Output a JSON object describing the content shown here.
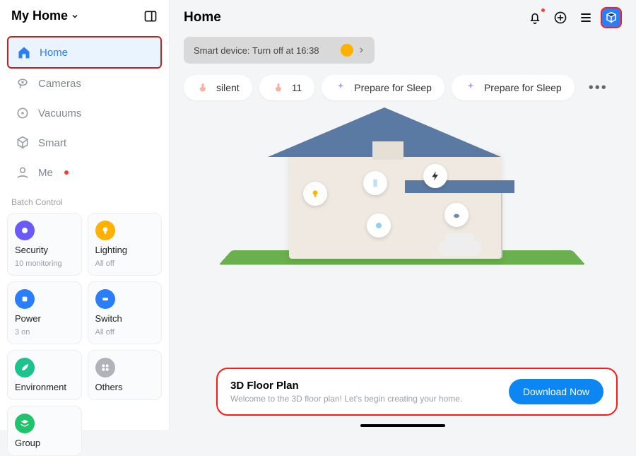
{
  "sidebar": {
    "title": "My Home",
    "nav": [
      {
        "label": "Home",
        "icon": "home"
      },
      {
        "label": "Cameras",
        "icon": "camera"
      },
      {
        "label": "Vacuums",
        "icon": "vacuum"
      },
      {
        "label": "Smart",
        "icon": "cube"
      },
      {
        "label": "Me",
        "icon": "person",
        "dot": true
      }
    ],
    "batch_label": "Batch Control",
    "batch": [
      {
        "t1": "Security",
        "t2": "10 monitoring",
        "color": "#6a5af9",
        "icon": "camera"
      },
      {
        "t1": "Lighting",
        "t2": "All off",
        "color": "#ffb100",
        "icon": "bulb"
      },
      {
        "t1": "Power",
        "t2": "3 on",
        "color": "#2a7efc",
        "icon": "plug"
      },
      {
        "t1": "Switch",
        "t2": "All off",
        "color": "#2a7efc",
        "icon": "switch"
      },
      {
        "t1": "Environment",
        "t2": "",
        "color": "#1dc28f",
        "icon": "leaf"
      },
      {
        "t1": "Others",
        "t2": "",
        "color": "#b0b4ba",
        "icon": "grid"
      },
      {
        "t1": "Group",
        "t2": "",
        "color": "#1fc36b",
        "icon": "stack"
      }
    ]
  },
  "main": {
    "title": "Home",
    "banner": "Smart device: Turn off at 16:38",
    "scenes": [
      {
        "label": "silent",
        "icon": "tap"
      },
      {
        "label": "11",
        "icon": "tap"
      },
      {
        "label": "Prepare for Sleep",
        "icon": "sparkle"
      },
      {
        "label": "Prepare for Sleep",
        "icon": "sparkle"
      }
    ],
    "floorplan": {
      "title": "3D Floor Plan",
      "subtitle": "Welcome to the 3D floor plan! Let's begin creating your home.",
      "button": "Download Now"
    }
  }
}
